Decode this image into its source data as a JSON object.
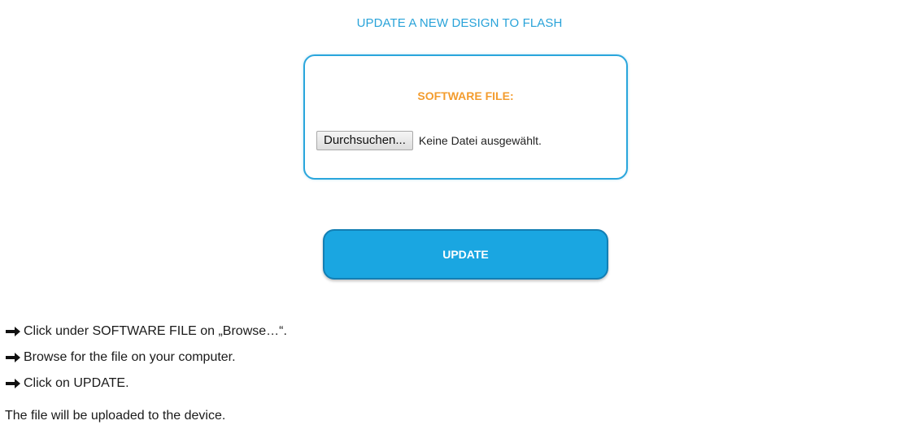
{
  "heading": "UPDATE A NEW DESIGN TO FLASH",
  "file_panel": {
    "title": "SOFTWARE FILE:",
    "browse_label": "Durchsuchen...",
    "status_text": "Keine Datei ausgewählt."
  },
  "update_button": {
    "label": "UPDATE"
  },
  "instructions": [
    {
      "icon": "arrow-right-icon",
      "text": "Click under SOFTWARE FILE on „Browse…“."
    },
    {
      "icon": "arrow-right-icon",
      "text": "Browse for the file on your computer."
    },
    {
      "icon": "arrow-right-icon",
      "text": "Click on UPDATE."
    }
  ],
  "result_note": "The file will be uploaded to the device.",
  "colors": {
    "heading": "#29a3d9",
    "panel_border": "#2aa6dc",
    "panel_title": "#f39c2e",
    "update_button_bg": "#1aa6e1",
    "update_button_border": "#137fb4",
    "text": "#1a1a1a"
  }
}
